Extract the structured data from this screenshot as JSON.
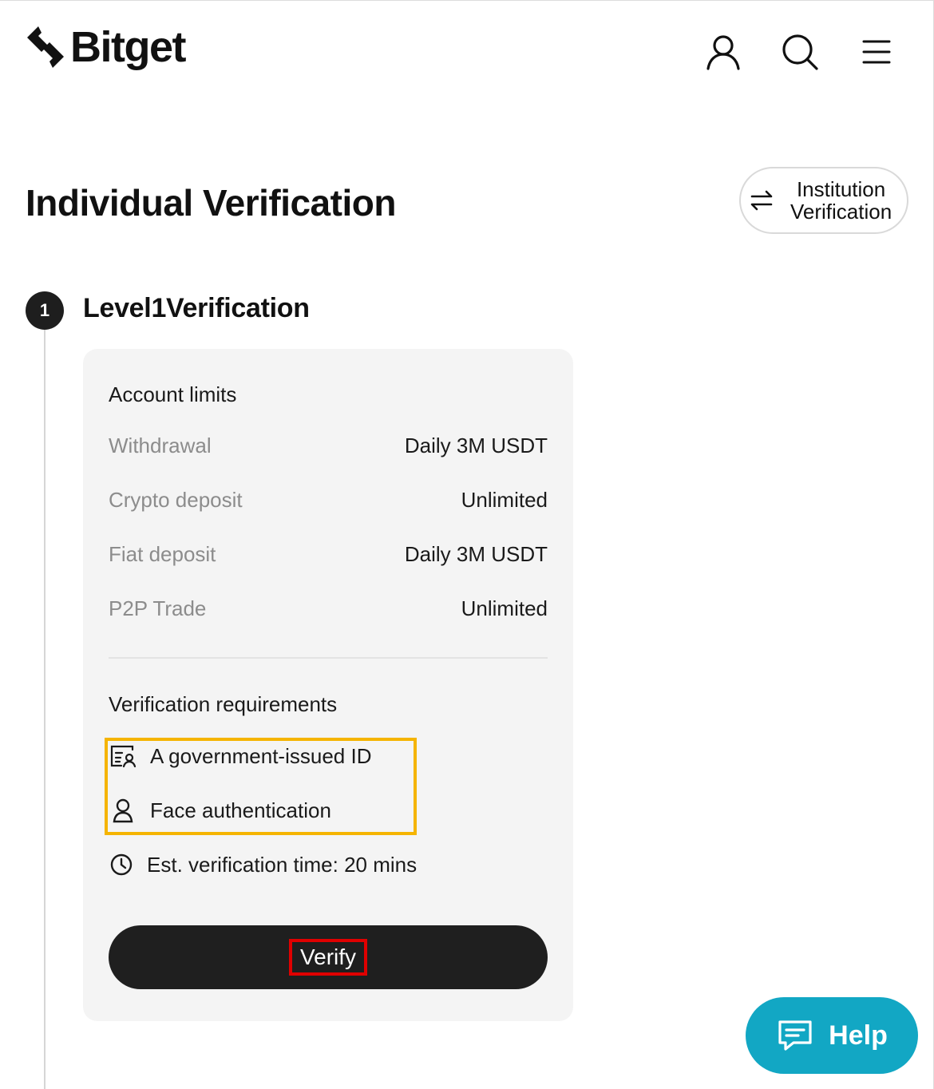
{
  "header": {
    "logo_text": "Bitget",
    "icons": [
      "user-icon",
      "search-icon",
      "menu-icon"
    ]
  },
  "page": {
    "title": "Individual Verification",
    "switch_button": {
      "line1": "Institution",
      "line2": "Verification",
      "icon": "swap-arrows-icon"
    }
  },
  "level": {
    "number": "1",
    "title": "Level1Verification",
    "account_limits": {
      "heading": "Account limits",
      "rows": [
        {
          "label": "Withdrawal",
          "value": "Daily 3M USDT"
        },
        {
          "label": "Crypto deposit",
          "value": "Unlimited"
        },
        {
          "label": "Fiat deposit",
          "value": "Daily 3M USDT"
        },
        {
          "label": "P2P Trade",
          "value": "Unlimited"
        }
      ]
    },
    "requirements": {
      "heading": "Verification requirements",
      "items": [
        {
          "text": "A government-issued ID",
          "icon": "id-card-icon"
        },
        {
          "text": "Face authentication",
          "icon": "person-icon"
        }
      ],
      "time": {
        "text": "Est. verification time: 20 mins",
        "icon": "clock-icon"
      }
    },
    "verify_button": "Verify"
  },
  "help_button": {
    "label": "Help",
    "icon": "chat-icon"
  },
  "colors": {
    "accent_dark": "#1f1f1f",
    "help": "#12a7c4",
    "highlight_yellow": "#f5b400",
    "highlight_red": "#e00000"
  }
}
